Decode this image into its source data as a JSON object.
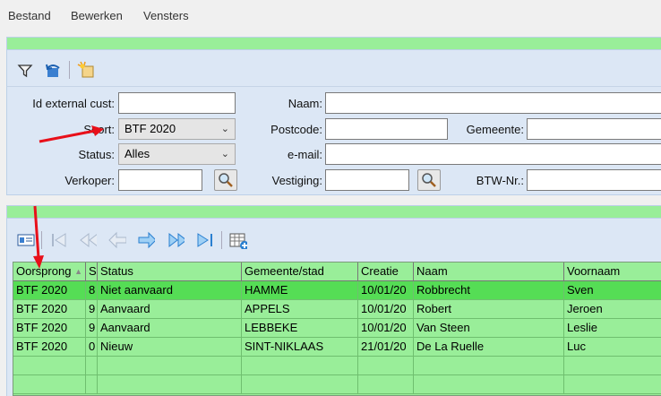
{
  "menu": {
    "file": "Bestand",
    "edit": "Bewerken",
    "windows": "Vensters"
  },
  "form": {
    "id_external_label": "Id external cust:",
    "id_external_value": "",
    "sort_label": "Soort:",
    "sort_value": "BTF 2020",
    "status_label": "Status:",
    "status_value": "Alles",
    "seller_label": "Verkoper:",
    "seller_value": "",
    "name_label": "Naam:",
    "name_value": "",
    "postcode_label": "Postcode:",
    "postcode_value": "",
    "municipality_label": "Gemeente:",
    "municipality_value": "",
    "email_label": "e-mail:",
    "email_value": "",
    "branch_label": "Vestiging:",
    "branch_value": "",
    "vat_label": "BTW-Nr.:",
    "vat_value": ""
  },
  "table": {
    "columns": [
      "Oorsprong",
      "S",
      "Status",
      "Gemeente/stad",
      "Creatie",
      "Naam",
      "Voornaam"
    ],
    "rows": [
      [
        "BTF 2020",
        "8",
        "Niet aanvaard",
        "HAMME",
        "10/01/20",
        "Robbrecht",
        "Sven"
      ],
      [
        "BTF 2020",
        "9",
        "Aanvaard",
        "APPELS",
        "10/01/20",
        "Robert",
        "Jeroen"
      ],
      [
        "BTF 2020",
        "9",
        "Aanvaard",
        "LEBBEKE",
        "10/01/20",
        "Van Steen",
        "Leslie"
      ],
      [
        "BTF 2020",
        "0",
        "Nieuw",
        "SINT-NIKLAAS",
        "21/01/20",
        "De La Ruelle",
        "Luc"
      ]
    ]
  },
  "colors": {
    "green": "#99ee99",
    "selected_row": "#55dd55",
    "panel": "#dce7f5",
    "arrow": "#e8101a"
  }
}
